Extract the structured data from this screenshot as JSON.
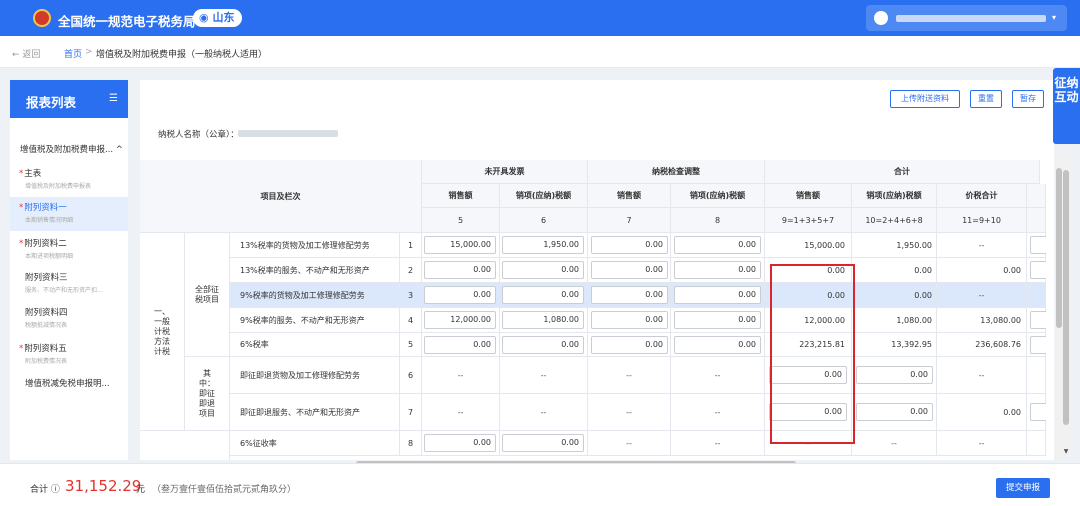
{
  "header": {
    "brand": "全国统一规范电子税务局",
    "province": "山东",
    "province_icon": "location-pin-icon",
    "user_caret": "▾"
  },
  "breadcrumb": {
    "back": "← 返回",
    "home": "首页",
    "sep": ">",
    "current": "增值税及附加税费申报（一般纳税人适用）"
  },
  "sidebar": {
    "title": "报表列表",
    "group": "增值税及附加税费申报... ^",
    "items": [
      {
        "name": "主表",
        "sub": "增值税及附加税费申报表"
      },
      {
        "name": "附列资料一",
        "sub": "本期销售情况明细"
      },
      {
        "name": "附列资料二",
        "sub": "本期进项税额明细"
      },
      {
        "name": "附列资料三",
        "sub": "服务、不动产和无形资产扣..."
      },
      {
        "name": "附列资料四",
        "sub": "税额抵减情况表"
      },
      {
        "name": "附列资料五",
        "sub": "附加税费情况表"
      },
      {
        "name": "增值税减免税申报明..."
      }
    ]
  },
  "toolbar": {
    "upload": "上传附送资料",
    "reset": "重置",
    "save": "暂存"
  },
  "taxpayer": {
    "label": "纳税人名称（公章）："
  },
  "table": {
    "h_item": "项目及栏次",
    "h_g1": "未开具发票",
    "h_g2": "纳税检查调整",
    "h_g3": "合计",
    "h_sales": "销售额",
    "h_tax": "销项(应纳)税额",
    "h_total": "价税合计",
    "nums": [
      "5",
      "6",
      "7",
      "8",
      "9=1+3+5+7",
      "10=2+4+6+8",
      "11=9+10"
    ],
    "cat1": "一、一般计税方法计税",
    "cat1a": "全部征税项目",
    "cat1b": "其中：即征即退项目",
    "rows": [
      {
        "label": "13%税率的货物及加工修理修配劳务",
        "no": "1",
        "c5": "15,000.00",
        "c6": "1,950.00",
        "c7": "0.00",
        "c8": "0.00",
        "c9": "15,000.00",
        "c10": "1,950.00",
        "c11": "--"
      },
      {
        "label": "13%税率的服务、不动产和无形资产",
        "no": "2",
        "c5": "0.00",
        "c6": "0.00",
        "c7": "0.00",
        "c8": "0.00",
        "c9": "0.00",
        "c10": "0.00",
        "c11": "0.00"
      },
      {
        "label": "9%税率的货物及加工修理修配劳务",
        "no": "3",
        "c5": "0.00",
        "c6": "0.00",
        "c7": "0.00",
        "c8": "0.00",
        "c9": "0.00",
        "c10": "0.00",
        "c11": "--"
      },
      {
        "label": "9%税率的服务、不动产和无形资产",
        "no": "4",
        "c5": "12,000.00",
        "c6": "1,080.00",
        "c7": "0.00",
        "c8": "0.00",
        "c9": "12,000.00",
        "c10": "1,080.00",
        "c11": "13,080.00"
      },
      {
        "label": "6%税率",
        "no": "5",
        "c5": "0.00",
        "c6": "0.00",
        "c7": "0.00",
        "c8": "0.00",
        "c9": "223,215.81",
        "c10": "13,392.95",
        "c11": "236,608.76"
      },
      {
        "label": "即征即退货物及加工修理修配劳务",
        "no": "6",
        "c5": "--",
        "c6": "--",
        "c7": "--",
        "c8": "--",
        "c9": "0.00",
        "c10": "0.00",
        "c11": "--"
      },
      {
        "label": "即征即退服务、不动产和无形资产",
        "no": "7",
        "c5": "--",
        "c6": "--",
        "c7": "--",
        "c8": "--",
        "c9": "0.00",
        "c10": "0.00",
        "c11": "0.00"
      },
      {
        "label": "6%征收率",
        "no": "8",
        "c5": "0.00",
        "c6": "0.00",
        "c7": "--",
        "c8": "--",
        "c9": "--",
        "c10": "--",
        "c11": "--"
      }
    ]
  },
  "right_tab": "征纳互动",
  "footer": {
    "total_label": "合计 ⓘ",
    "amount": "31,152.29",
    "unit": "元",
    "words": "（叁万壹仟壹佰伍拾贰元贰角玖分）",
    "submit": "提交申报"
  },
  "colors": {
    "primary": "#2a6ff0",
    "highlight_border": "#d8262c",
    "amount": "#e5322d"
  }
}
